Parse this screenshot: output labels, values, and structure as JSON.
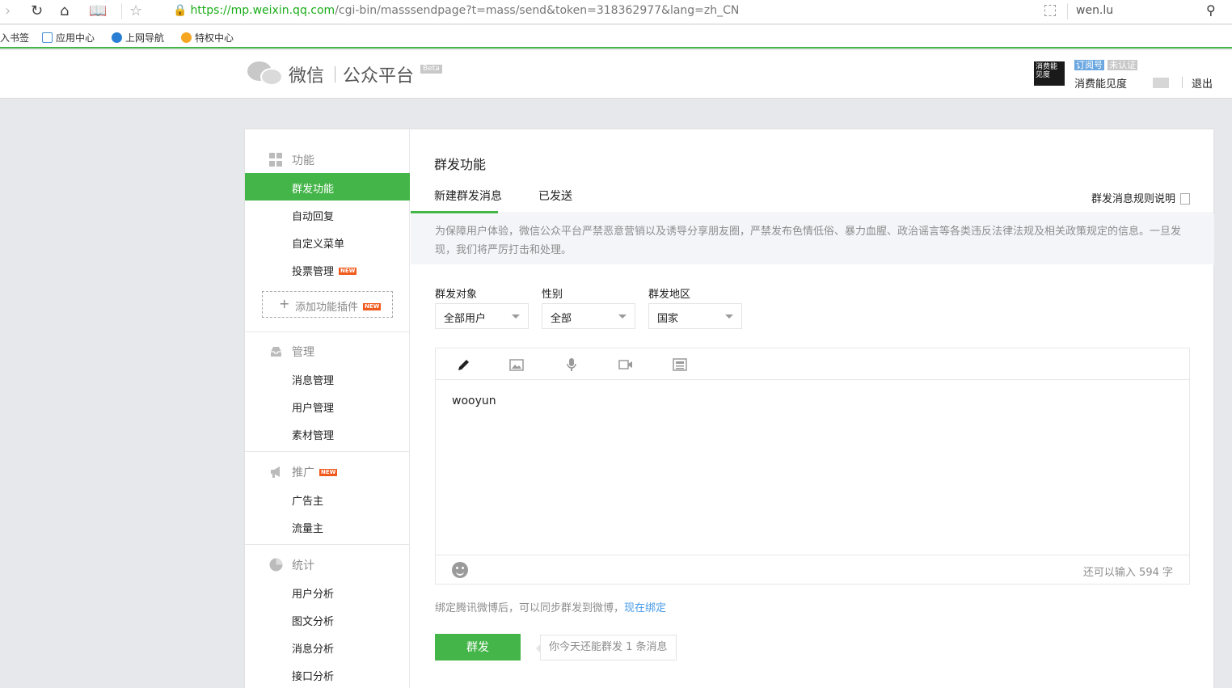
{
  "browser": {
    "url_scheme": "https://",
    "url_host": "mp.weixin.qq.com",
    "url_path": "/cgi-bin/masssendpage?t=mass/send&token=318362977&lang=zh_CN",
    "search_text": "wen.lu",
    "bookmarks": [
      {
        "label": "入书签",
        "color": "#ffffff"
      },
      {
        "label": "应用中心",
        "color": "#4a90d9"
      },
      {
        "label": "上网导航",
        "color": "#2a7fd4"
      },
      {
        "label": "特权中心",
        "color": "#f5a623"
      }
    ]
  },
  "header": {
    "logo_wechat": "微信",
    "logo_platform": "公众平台",
    "beta": "Beta",
    "account_tag_type": "订阅号",
    "account_tag_status": "未认证",
    "account_name": "消费能见度",
    "logout": "退出"
  },
  "sidebar": {
    "groups": [
      {
        "title": "功能",
        "items": [
          "群发功能",
          "自动回复",
          "自定义菜单",
          "投票管理"
        ]
      },
      {
        "title": "管理",
        "items": [
          "消息管理",
          "用户管理",
          "素材管理"
        ]
      },
      {
        "title": "推广",
        "items": [
          "广告主",
          "流量主"
        ]
      },
      {
        "title": "统计",
        "items": [
          "用户分析",
          "图文分析",
          "消息分析",
          "接口分析"
        ]
      }
    ],
    "add_plugin": "添加功能插件",
    "new_badge": "NEW"
  },
  "main": {
    "title": "群发功能",
    "tabs": [
      "新建群发消息",
      "已发送"
    ],
    "rules_link": "群发消息规则说明",
    "notice": "为保障用户体验，微信公众平台严禁恶意营销以及诱导分享朋友圈，严禁发布色情低俗、暴力血腥、政治谣言等各类违反法律法规及相关政策规定的信息。一旦发现，我们将严厉打击和处理。",
    "filters": [
      {
        "label": "群发对象",
        "value": "全部用户"
      },
      {
        "label": "性别",
        "value": "全部"
      },
      {
        "label": "群发地区",
        "value": "国家"
      }
    ],
    "editor_text": "wooyun",
    "remaining": "还可以输入 594 字",
    "bind_text": "绑定腾讯微博后，可以同步群发到微博，",
    "bind_link": "现在绑定",
    "send_button": "群发",
    "quota": "你今天还能群发 1 条消息"
  },
  "colors": {
    "accent": "#44b549",
    "link": "#459ae9",
    "new_badge": "#f05a1c"
  }
}
